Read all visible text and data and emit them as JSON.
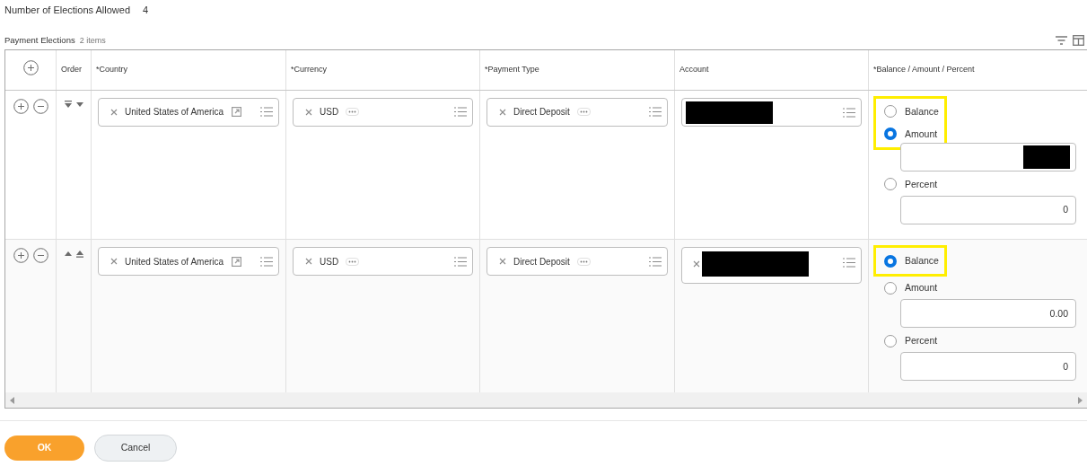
{
  "elections_allowed": {
    "label": "Number of Elections Allowed",
    "value": "4"
  },
  "grid": {
    "title": "Payment Elections",
    "count": "2 items",
    "columns": [
      "Order",
      "*Country",
      "*Currency",
      "*Payment Type",
      "Account",
      "*Balance / Amount / Percent"
    ],
    "rows": [
      {
        "can_move_up": false,
        "can_move_down": true,
        "country": "United States of America",
        "currency": "USD",
        "payment_type": "Direct Deposit",
        "account_redacted": true,
        "account_clear_shown": false,
        "options": [
          {
            "kind": "radio",
            "label": "Balance",
            "selected": false,
            "highlighted": true
          },
          {
            "kind": "radio-input",
            "label": "Amount",
            "selected": true,
            "highlighted": true,
            "redacted": true
          },
          {
            "kind": "radio-input",
            "label": "Percent",
            "selected": false,
            "highlighted": false,
            "value": "0",
            "redacted": false
          }
        ]
      },
      {
        "can_move_up": true,
        "can_move_down": false,
        "country": "United States of America",
        "currency": "USD",
        "payment_type": "Direct Deposit",
        "account_redacted": true,
        "account_clear_shown": true,
        "options": [
          {
            "kind": "radio",
            "label": "Balance",
            "selected": true,
            "highlighted": true
          },
          {
            "kind": "radio-input",
            "label": "Amount",
            "selected": false,
            "highlighted": false,
            "value": "0.00",
            "redacted": false
          },
          {
            "kind": "radio-input",
            "label": "Percent",
            "selected": false,
            "highlighted": false,
            "value": "0",
            "redacted": false
          }
        ]
      }
    ]
  },
  "buttons": [
    {
      "label": "OK",
      "kind": "primary"
    },
    {
      "label": "Cancel",
      "kind": "secondary"
    }
  ]
}
